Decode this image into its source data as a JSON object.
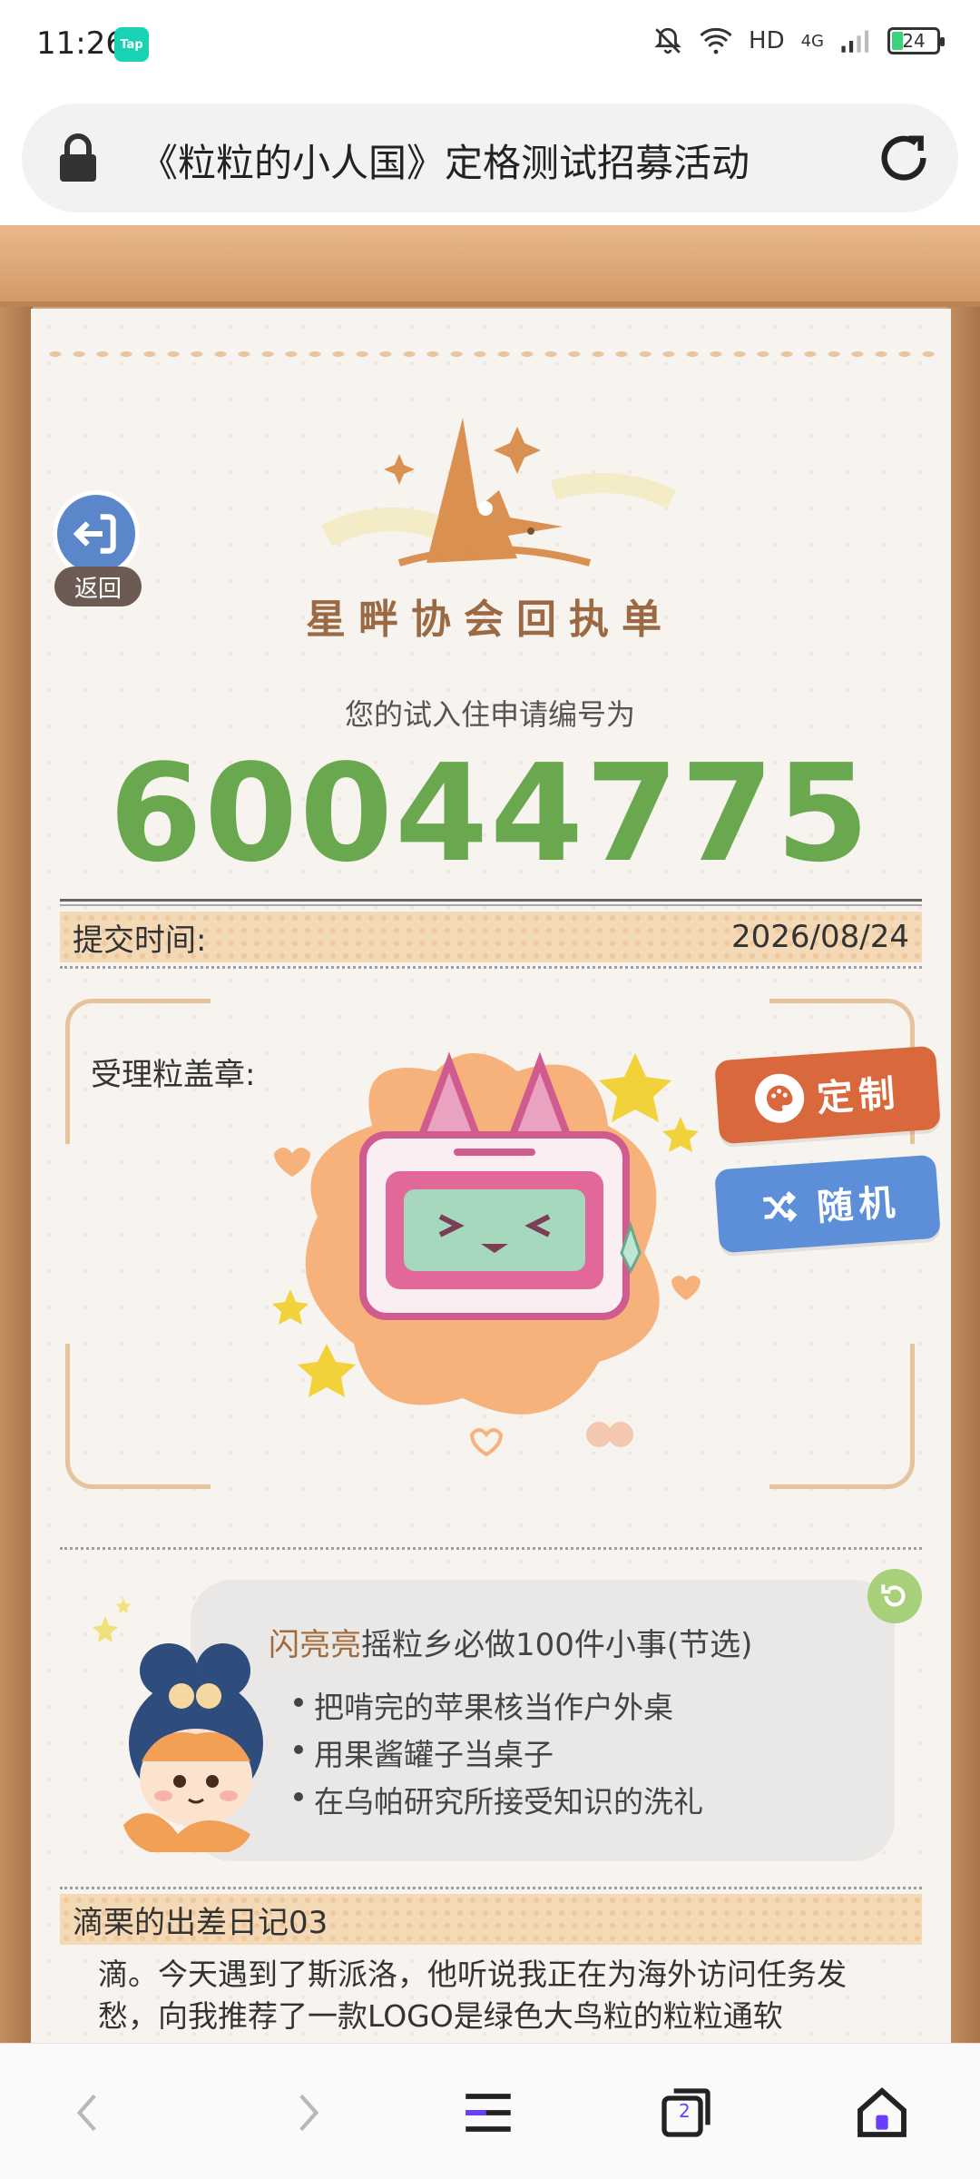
{
  "status_bar": {
    "time": "11:26",
    "app_badge": "Tap",
    "network": "HD",
    "signal": "4G",
    "battery": "24"
  },
  "browser": {
    "page_title": "《粒粒的小人国》定格测试招募活动",
    "tab_count": "2"
  },
  "page": {
    "back_label": "返回",
    "header_title": "星畔协会回执单",
    "apply_caption": "您的试入住申请编号为",
    "apply_number": "60044775",
    "submit_label": "提交时间:",
    "submit_date": "2026/08/24",
    "stamp_label": "受理粒盖章:",
    "custom_button": "定制",
    "random_button": "随机",
    "card": {
      "title_highlight": "闪亮亮",
      "title_rest": "摇粒乡必做100件小事(节选)",
      "items": [
        "把啃完的苹果核当作户外桌",
        "用果酱罐子当桌子",
        "在乌帕研究所接受知识的洗礼"
      ]
    },
    "diary_title": "滴栗的出差日记03",
    "diary_text": "滴。今天遇到了斯派洛，他听说我正在为海外访问任务发愁，向我推荐了一款LOGO是绿色大鸟粒的粒粒通软"
  },
  "colors": {
    "accent_green": "#6aa84f",
    "custom_orange": "#d9683c",
    "random_blue": "#5c8fd8",
    "tab_strip": "#f4d9b7"
  }
}
